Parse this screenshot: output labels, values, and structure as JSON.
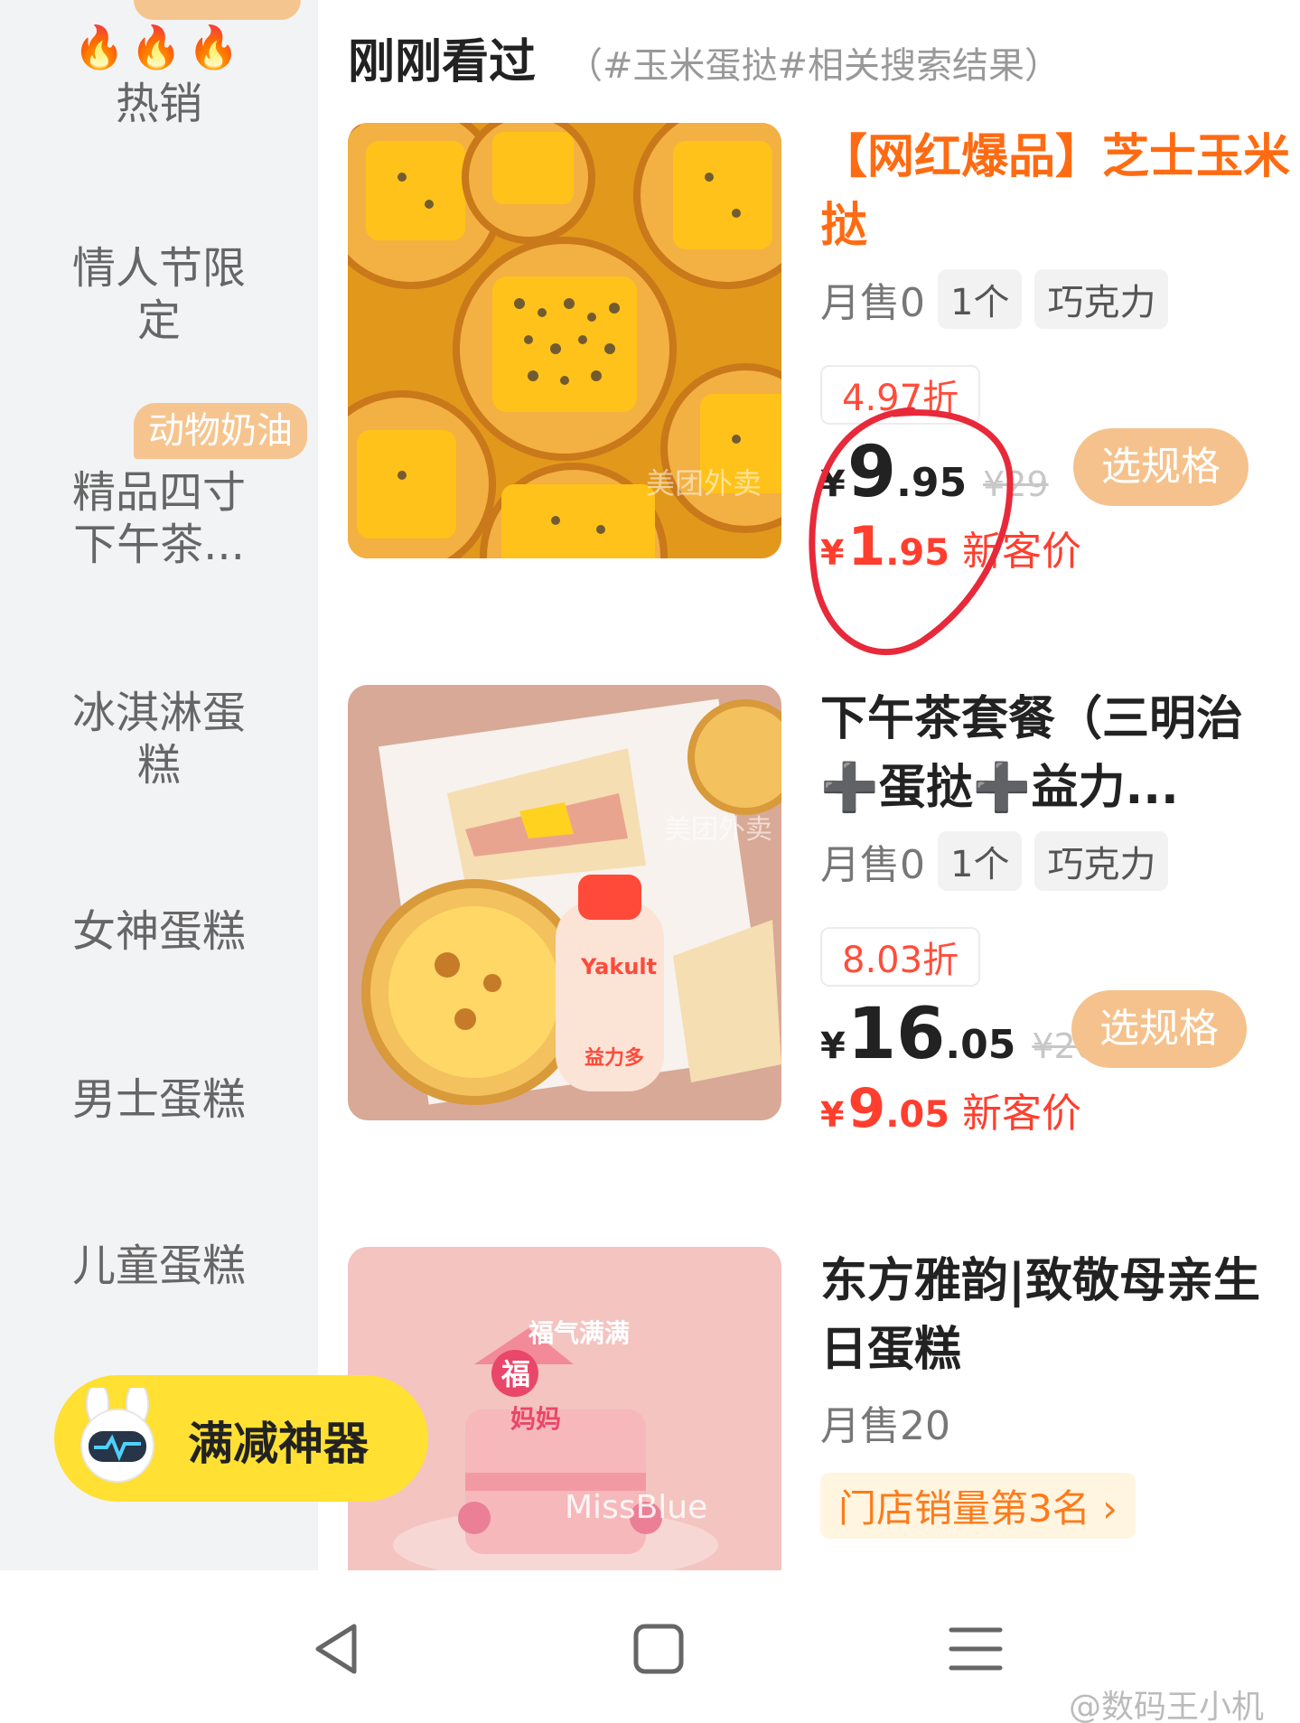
{
  "sidebar": {
    "top_badge": "",
    "hot": {
      "flames": "🔥🔥🔥",
      "label": "热销"
    },
    "categories": [
      {
        "label": "情人节限\n定"
      },
      {
        "label": "精品四寸\n下午茶...",
        "badge": "动物奶油"
      },
      {
        "label": "冰淇淋蛋\n糕"
      },
      {
        "label": "女神蛋糕"
      },
      {
        "label": "男士蛋糕"
      },
      {
        "label": "儿童蛋糕"
      }
    ]
  },
  "header": {
    "title": "刚刚看过",
    "subtitle": "（#玉米蛋挞#相关搜索结果）"
  },
  "products": [
    {
      "name": "【网红爆品】芝士玉米挞",
      "monthly_sales": "月售0",
      "chips": [
        "1个",
        "巧克力"
      ],
      "discount": "4.97折",
      "currency": "¥",
      "price_int": "9",
      "price_dec": ".95",
      "price_original": "¥29",
      "spec_button": "选规格",
      "new_currency": "¥",
      "new_price_int": "1",
      "new_price_dec": ".95",
      "new_label": "新客价",
      "image_watermark": "美团外卖"
    },
    {
      "name": "下午茶套餐（三明治➕蛋挞➕益力...",
      "monthly_sales": "月售0",
      "chips": [
        "1个",
        "巧克力"
      ],
      "discount": "8.03折",
      "currency": "¥",
      "price_int": "16",
      "price_dec": ".05",
      "price_original": "¥20",
      "spec_button": "选规格",
      "new_currency": "¥",
      "new_price_int": "9",
      "new_price_dec": ".05",
      "new_label": "新客价",
      "image_text": [
        "Yakult",
        "益力多"
      ],
      "image_watermark": "美团外卖"
    },
    {
      "name": "东方雅韵|致敬母亲生日蛋糕",
      "monthly_sales": "月售20",
      "rank": "门店销量第3名",
      "rank_arrow": "›",
      "image_text": [
        "福气满满",
        "福",
        "妈妈",
        "MissBlue"
      ]
    }
  ],
  "floating": {
    "label": "满减神器",
    "color": "#ffe033"
  },
  "nav": {
    "back_icon": "back-triangle-icon",
    "home_icon": "home-square-icon",
    "menu_icon": "menu-lines-icon"
  },
  "watermark": "@数码王小机",
  "colors": {
    "accent": "#ff6b12",
    "price_red": "#ff3e2e",
    "button": "#f5c28d",
    "sidebar_bg": "#f2f3f5"
  }
}
